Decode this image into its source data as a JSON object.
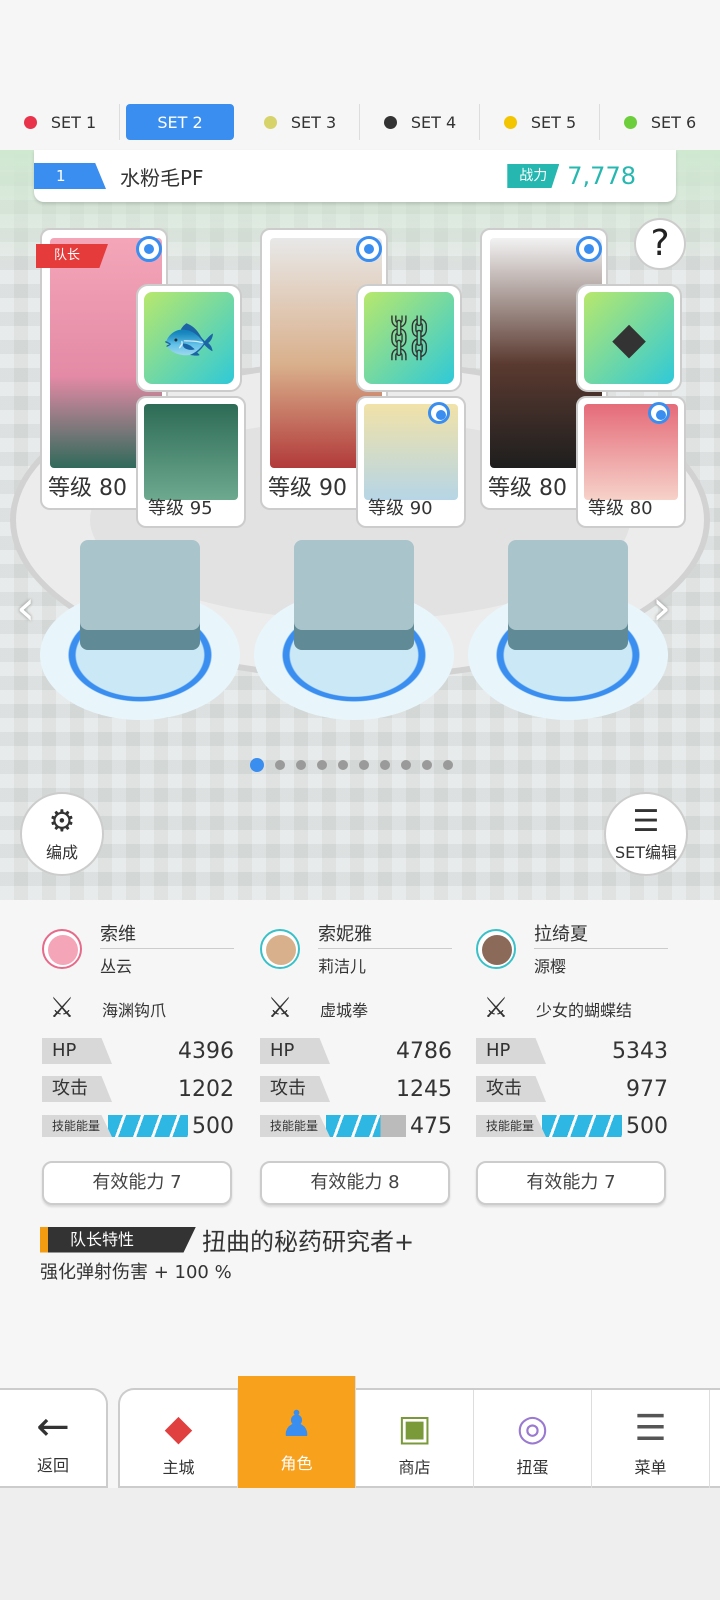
{
  "set_tabs": [
    {
      "label": "SET 1",
      "color": "#e8334a",
      "active": false
    },
    {
      "label": "SET 2",
      "color": "#3a8ef0",
      "active": true
    },
    {
      "label": "SET 3",
      "color": "#d6d36a",
      "active": false
    },
    {
      "label": "SET 4",
      "color": "#333333",
      "active": false
    },
    {
      "label": "SET 5",
      "color": "#f2c500",
      "active": false
    },
    {
      "label": "SET 6",
      "color": "#6cce3a",
      "active": false
    }
  ],
  "team": {
    "number": "1",
    "name": "水粉毛PF",
    "power_label": "战力",
    "power_value": "7,778"
  },
  "help_label": "?",
  "leader_tag": "队长",
  "characters": [
    {
      "main_level": "等级 80",
      "sub_level": "等级 95",
      "equip_icon": "fish-icon",
      "main_color": "#f4a6b8",
      "sub_color": "#2e6b56"
    },
    {
      "main_level": "等级 90",
      "sub_level": "等级 90",
      "equip_icon": "cannon-icon",
      "main_color": "#d9b08c",
      "sub_color": "#f1e2a8"
    },
    {
      "main_level": "等级 80",
      "sub_level": "等级 80",
      "equip_icon": "crystal-icon",
      "main_color": "#e6e6e6",
      "sub_color": "#e56b79"
    }
  ],
  "arrows": {
    "left": "‹",
    "right": "›"
  },
  "pager": {
    "count": 10,
    "active": 0
  },
  "formation_button": "编成",
  "set_edit_button": "SET编辑",
  "stat_columns": [
    {
      "name": "索维",
      "subname": "丛云",
      "weapon": "海渊钩爪",
      "hp_label": "HP",
      "hp": "4396",
      "atk_label": "攻击",
      "atk": "1202",
      "energy_label": "技能能量",
      "energy": "500",
      "ability": "有效能力 7",
      "avatar_color": "#f4a6b8"
    },
    {
      "name": "索妮雅",
      "subname": "莉洁儿",
      "weapon": "虚城拳",
      "hp_label": "HP",
      "hp": "4786",
      "atk_label": "攻击",
      "atk": "1245",
      "energy_label": "技能能量",
      "energy": "475",
      "ability": "有效能力 8",
      "avatar_color": "#d9b08c"
    },
    {
      "name": "拉绮夏",
      "subname": "源樱",
      "weapon": "少女的蝴蝶结",
      "hp_label": "HP",
      "hp": "5343",
      "atk_label": "攻击",
      "atk": "977",
      "energy_label": "技能能量",
      "energy": "500",
      "ability": "有效能力 7",
      "avatar_color": "#8c6a5a"
    }
  ],
  "leader_trait": {
    "tag": "队长特性",
    "name": "扭曲的秘药研究者+",
    "desc": "强化弹射伤害 + 100 %"
  },
  "nav": {
    "back": "返回",
    "items": [
      {
        "label": "主城",
        "icon": "town-icon",
        "active": false
      },
      {
        "label": "角色",
        "icon": "character-icon",
        "active": true
      },
      {
        "label": "商店",
        "icon": "shop-icon",
        "active": false
      },
      {
        "label": "扭蛋",
        "icon": "gacha-icon",
        "active": false
      },
      {
        "label": "菜单",
        "icon": "menu-icon",
        "active": false
      }
    ]
  }
}
